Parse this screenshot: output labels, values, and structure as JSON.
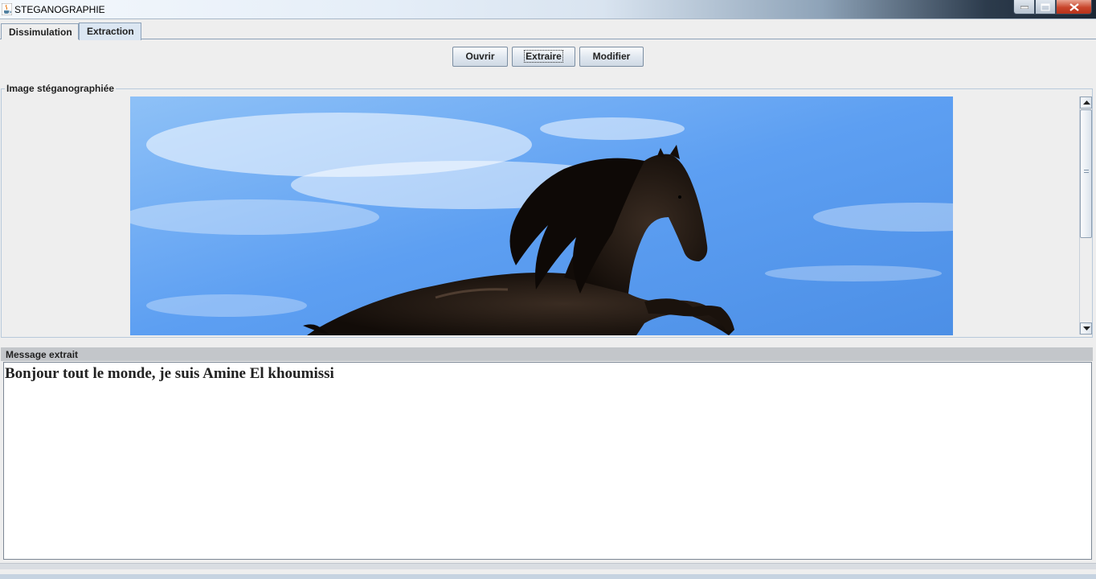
{
  "window": {
    "title": "STEGANOGRAPHIE",
    "icon": "java-cup-icon",
    "controls": [
      "minimize-icon",
      "maximize-icon",
      "close-icon"
    ]
  },
  "tabs": [
    {
      "label": "Dissimulation",
      "selected": false
    },
    {
      "label": "Extraction",
      "selected": true
    }
  ],
  "toolbar": {
    "open_label": "Ouvrir",
    "extract_label": "Extraire",
    "modify_label": "Modifier"
  },
  "image_panel": {
    "title": "Image stéganographiée",
    "image_description_icon": "horse-photo"
  },
  "message_panel": {
    "title": "Message extrait",
    "text": "Bonjour tout le monde, je suis Amine El khoumissi"
  },
  "colors": {
    "tab_selected": "#dbe6f2",
    "sky": "#5b9ff0",
    "close_button": "#c8452c"
  }
}
